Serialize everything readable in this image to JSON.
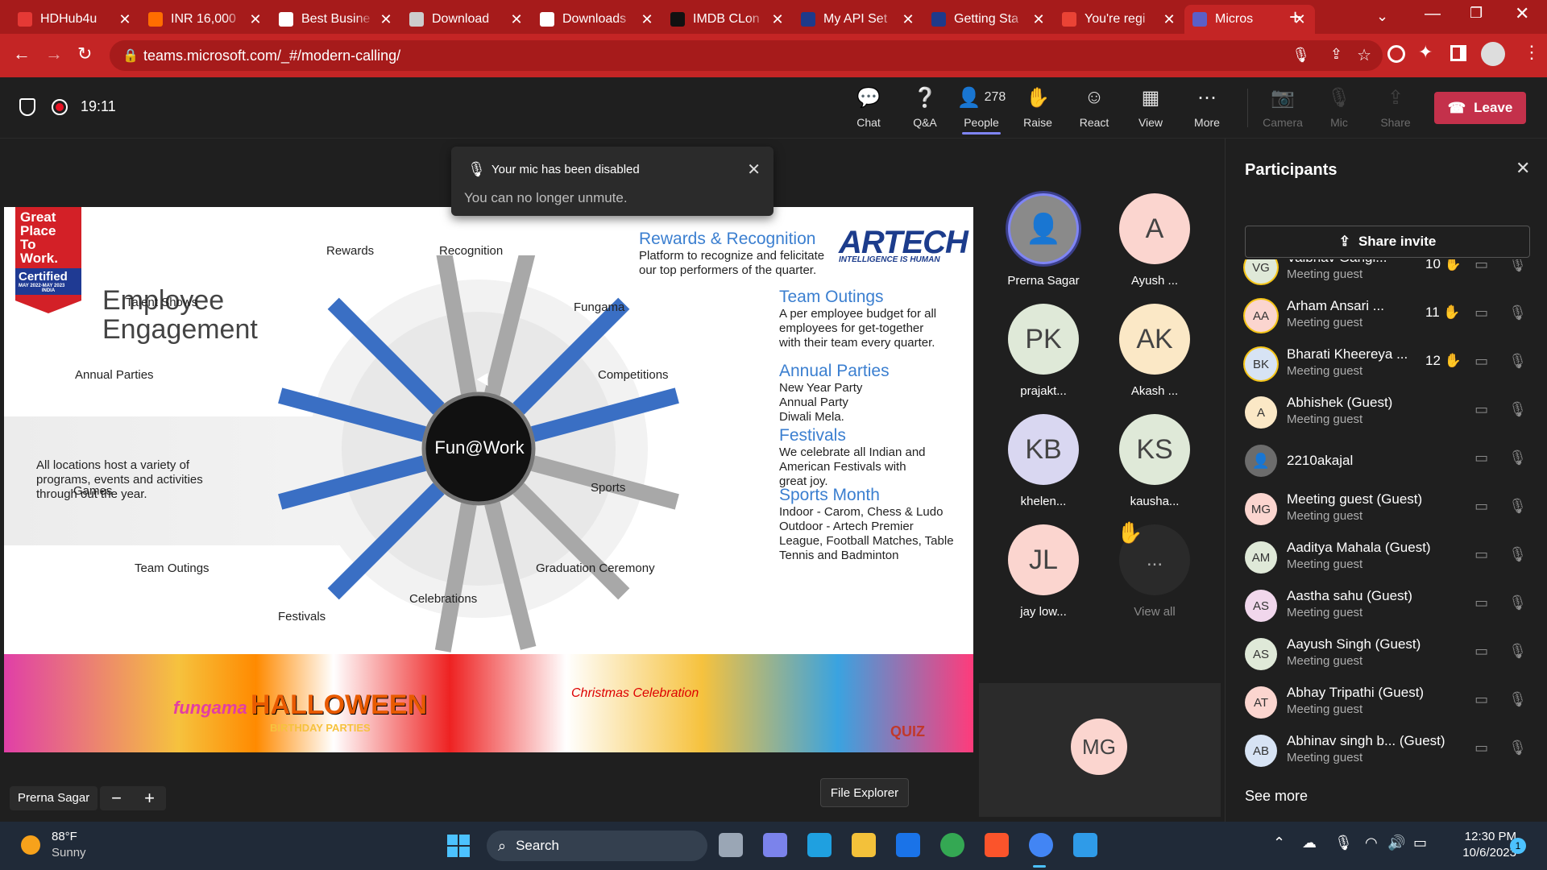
{
  "browser": {
    "tabs": [
      {
        "title": "HDHub4u",
        "favicon_color": "#e53935"
      },
      {
        "title": "INR 16,000",
        "favicon_color": "#ff6d00"
      },
      {
        "title": "Best Busine",
        "favicon_color": "#ffffff"
      },
      {
        "title": "Download",
        "favicon_color": "#cccccc"
      },
      {
        "title": "Downloads",
        "favicon_color": "#ffffff"
      },
      {
        "title": "IMDB CLon",
        "favicon_color": "#111111"
      },
      {
        "title": "My API Set",
        "favicon_color": "#1e3a8a"
      },
      {
        "title": "Getting Sta",
        "favicon_color": "#1e3a8a"
      },
      {
        "title": "You're regi",
        "favicon_color": "#ea4335"
      },
      {
        "title": "Micros",
        "favicon_color": "#5b5fc7",
        "active": true
      }
    ],
    "url": "teams.microsoft.com/_#/modern-calling/"
  },
  "meeting": {
    "timer": "19:11",
    "toolbar": [
      {
        "label": "Chat",
        "icon": "chat-icon"
      },
      {
        "label": "Q&A",
        "icon": "qa-icon"
      },
      {
        "label": "People",
        "icon": "people-icon",
        "count": "278"
      },
      {
        "label": "Raise",
        "icon": "hand-icon"
      },
      {
        "label": "React",
        "icon": "smile-icon"
      },
      {
        "label": "View",
        "icon": "view-icon"
      },
      {
        "label": "More",
        "icon": "more-icon"
      }
    ],
    "disabled_toolbar": [
      {
        "label": "Camera"
      },
      {
        "label": "Mic"
      },
      {
        "label": "Share"
      }
    ],
    "leave_label": "Leave"
  },
  "toast": {
    "title": "Your mic has been disabled",
    "body": "You can no longer unmute."
  },
  "slide": {
    "badge": [
      "Great",
      "Place",
      "To",
      "Work.",
      "Certified",
      "MAY 2022-MAY 2023",
      "INDIA"
    ],
    "title_line1": "Employee",
    "title_line2": "Engagement",
    "logo": "ARTECH",
    "logo_tag": "INTELLIGENCE IS HUMAN",
    "left_note": "All locations host a variety of programs, events and activities through out the year.",
    "center": "Fun@Work",
    "spokes": [
      "Rewards",
      "Recognition",
      "Fungama",
      "Competitions",
      "Sports",
      "Graduation Ceremony",
      "Celebrations",
      "Festivals",
      "Team Outings",
      "Games",
      "Annual Parties",
      "Talent Shows"
    ],
    "sections": [
      {
        "heading": "Rewards & Recognition",
        "lines": [
          "Platform to recognize and felicitate",
          "our top performers of the quarter."
        ]
      },
      {
        "heading": "Team Outings",
        "lines": [
          "A per employee budget for all",
          "employees for  get-together",
          "with their team every quarter."
        ]
      },
      {
        "heading": "Annual Parties",
        "lines": [
          "New Year Party",
          "Annual Party",
          "Diwali Mela."
        ]
      },
      {
        "heading": "Festivals",
        "lines": [
          "We celebrate all Indian and",
          "American Festivals with",
          "great joy."
        ]
      },
      {
        "heading": "Sports Month",
        "lines": [
          "Indoor - Carom, Chess & Ludo",
          "Outdoor - Artech Premier",
          "League, Football Matches, Table",
          "Tennis and Badminton"
        ]
      }
    ],
    "footer_words": [
      "fungama",
      "HALLOWEEN",
      "BIRTHDAY PARTIES",
      "Christmas Celebration",
      "QUIZ"
    ]
  },
  "presenter": {
    "name": "Prerna Sagar"
  },
  "gallery": [
    {
      "initials": "",
      "name": "Prerna Sagar",
      "color": "#8a8a8a"
    },
    {
      "initials": "A",
      "name": "Ayush ...",
      "color": "#fbd5cf"
    },
    {
      "initials": "PK",
      "name": "prajakt...",
      "color": "#dfe9d8"
    },
    {
      "initials": "AK",
      "name": "Akash ...",
      "color": "#fbe8c6"
    },
    {
      "initials": "KB",
      "name": "khelen...",
      "color": "#d9d7f1"
    },
    {
      "initials": "KS",
      "name": "kausha...",
      "color": "#dfe9d8"
    },
    {
      "initials": "JL",
      "name": "jay low...",
      "color": "#fbd5cf"
    },
    {
      "initials": "...",
      "name": "View all",
      "color": "#2a2a2a"
    }
  ],
  "spotlight": {
    "initials": "MG",
    "color": "#fbd5cf"
  },
  "participants": {
    "title": "Participants",
    "share_label": "Share invite",
    "see_more": "See more",
    "rows": [
      {
        "initials": "VG",
        "name": "Vaibhav Gangi...",
        "sub": "Meeting guest",
        "hand": "10",
        "color": "#dfe9d8"
      },
      {
        "initials": "AA",
        "name": "Arham Ansari ...",
        "sub": "Meeting guest",
        "hand": "11",
        "color": "#fbd5cf"
      },
      {
        "initials": "BK",
        "name": "Bharati Kheereya ...",
        "sub": "Meeting guest",
        "hand": "12",
        "color": "#d7e3f4"
      },
      {
        "initials": "A",
        "name": "Abhishek (Guest)",
        "sub": "Meeting guest",
        "hand": "",
        "color": "#fbe8c6"
      },
      {
        "initials": "",
        "name": "2210akajal",
        "sub": "",
        "hand": "",
        "color": "#6c6c6c"
      },
      {
        "initials": "MG",
        "name": "Meeting guest (Guest)",
        "sub": "Meeting guest",
        "hand": "",
        "color": "#fbd5cf"
      },
      {
        "initials": "AM",
        "name": "Aaditya Mahala (Guest)",
        "sub": "Meeting guest",
        "hand": "",
        "color": "#dfe9d8"
      },
      {
        "initials": "AS",
        "name": "Aastha sahu (Guest)",
        "sub": "Meeting guest",
        "hand": "",
        "color": "#f1d7ec"
      },
      {
        "initials": "AS",
        "name": "Aayush Singh (Guest)",
        "sub": "Meeting guest",
        "hand": "",
        "color": "#dfe9d8"
      },
      {
        "initials": "AT",
        "name": "Abhay Tripathi (Guest)",
        "sub": "Meeting guest",
        "hand": "",
        "color": "#fbd5cf"
      },
      {
        "initials": "AB",
        "name": "Abhinav singh b...  (Guest)",
        "sub": "Meeting guest",
        "hand": "",
        "color": "#d7e3f4"
      }
    ]
  },
  "taskbar": {
    "weather_temp": "88°F",
    "weather_desc": "Sunny",
    "search_label": "Search",
    "tooltip": "File Explorer",
    "time": "12:30 PM",
    "date": "10/6/2023",
    "notif_count": "1"
  }
}
